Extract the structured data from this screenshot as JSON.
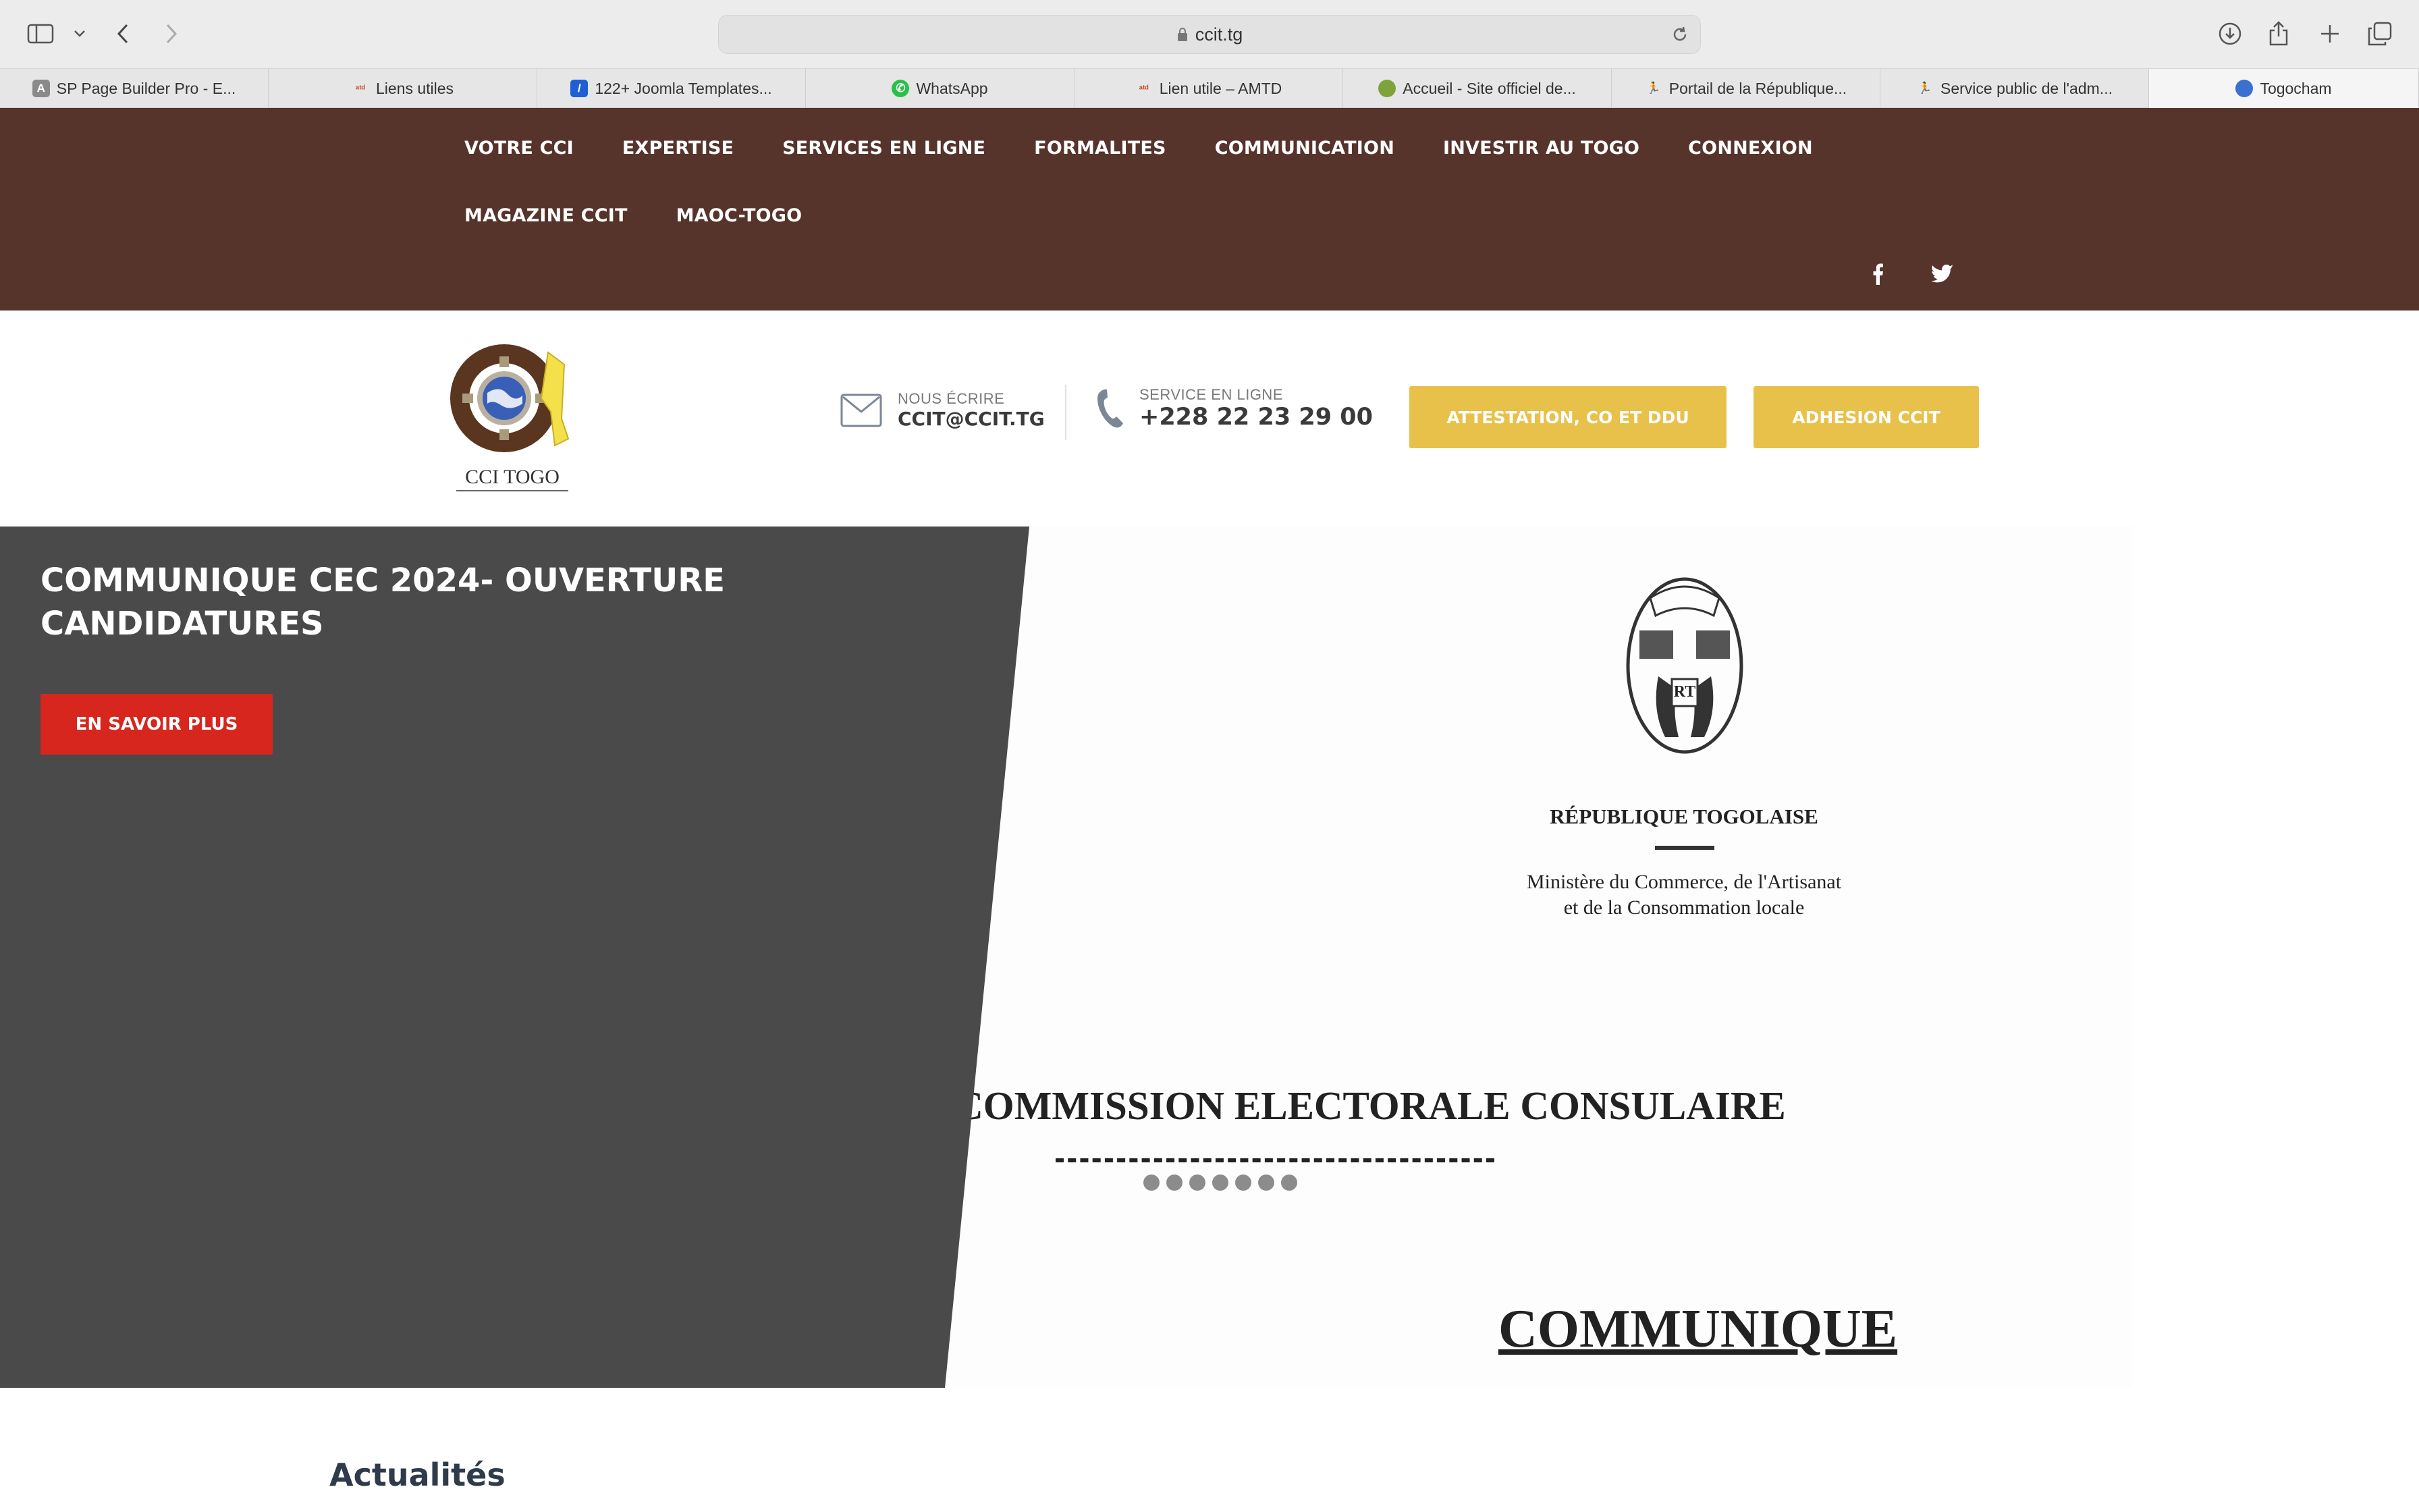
{
  "browser": {
    "url": "ccit.tg",
    "tabs": [
      {
        "label": "SP Page Builder Pro - E...",
        "icon": "a-square-icon"
      },
      {
        "label": "Liens utiles",
        "icon": "site-icon"
      },
      {
        "label": "122+ Joomla Templates...",
        "icon": "joomla-icon"
      },
      {
        "label": "WhatsApp",
        "icon": "whatsapp-icon"
      },
      {
        "label": "Lien utile – AMTD",
        "icon": "site-icon"
      },
      {
        "label": "Accueil - Site officiel de...",
        "icon": "site-icon"
      },
      {
        "label": "Portail de la République...",
        "icon": "runner-icon"
      },
      {
        "label": "Service public de l'adm...",
        "icon": "runner-icon"
      },
      {
        "label": "Togocham",
        "icon": "globe-icon"
      }
    ]
  },
  "nav": {
    "items": [
      "VOTRE CCI",
      "EXPERTISE",
      "SERVICES EN LIGNE",
      "FORMALITES",
      "COMMUNICATION",
      "INVESTIR AU TOGO",
      "CONNEXION",
      "MAGAZINE CCIT",
      "MAOC-TOGO"
    ]
  },
  "header": {
    "logo_text": "CCI TOGO",
    "email_label": "NOUS ÉCRIRE",
    "email_value": "CCIT@CCIT.TG",
    "phone_label": "SERVICE EN LIGNE",
    "phone_value": "+228 22 23 29 00",
    "cta1": "ATTESTATION, CO ET DDU",
    "cta2": "ADHESION CCIT"
  },
  "hero": {
    "title": "COMMUNIQUE CEC 2024- OUVERTURE CANDIDATURES",
    "button": "EN SAVOIR PLUS",
    "doc": {
      "republic": "RÉPUBLIQUE TOGOLAISE",
      "ministry_line1": "Ministère du Commerce, de l'Artisanat",
      "ministry_line2": "et de la Consommation locale",
      "commission": "COMMISSION ELECTORALE CONSULAIRE",
      "communique": "COMMUNIQUE",
      "seal_text": "RT"
    },
    "slide_count": 7
  },
  "news": {
    "title": "Actualités"
  },
  "colors": {
    "nav_bg": "#56342b",
    "accent_yellow": "#e8c14b",
    "hero_dark": "#4a4a4a",
    "hero_btn": "#d6261e"
  }
}
